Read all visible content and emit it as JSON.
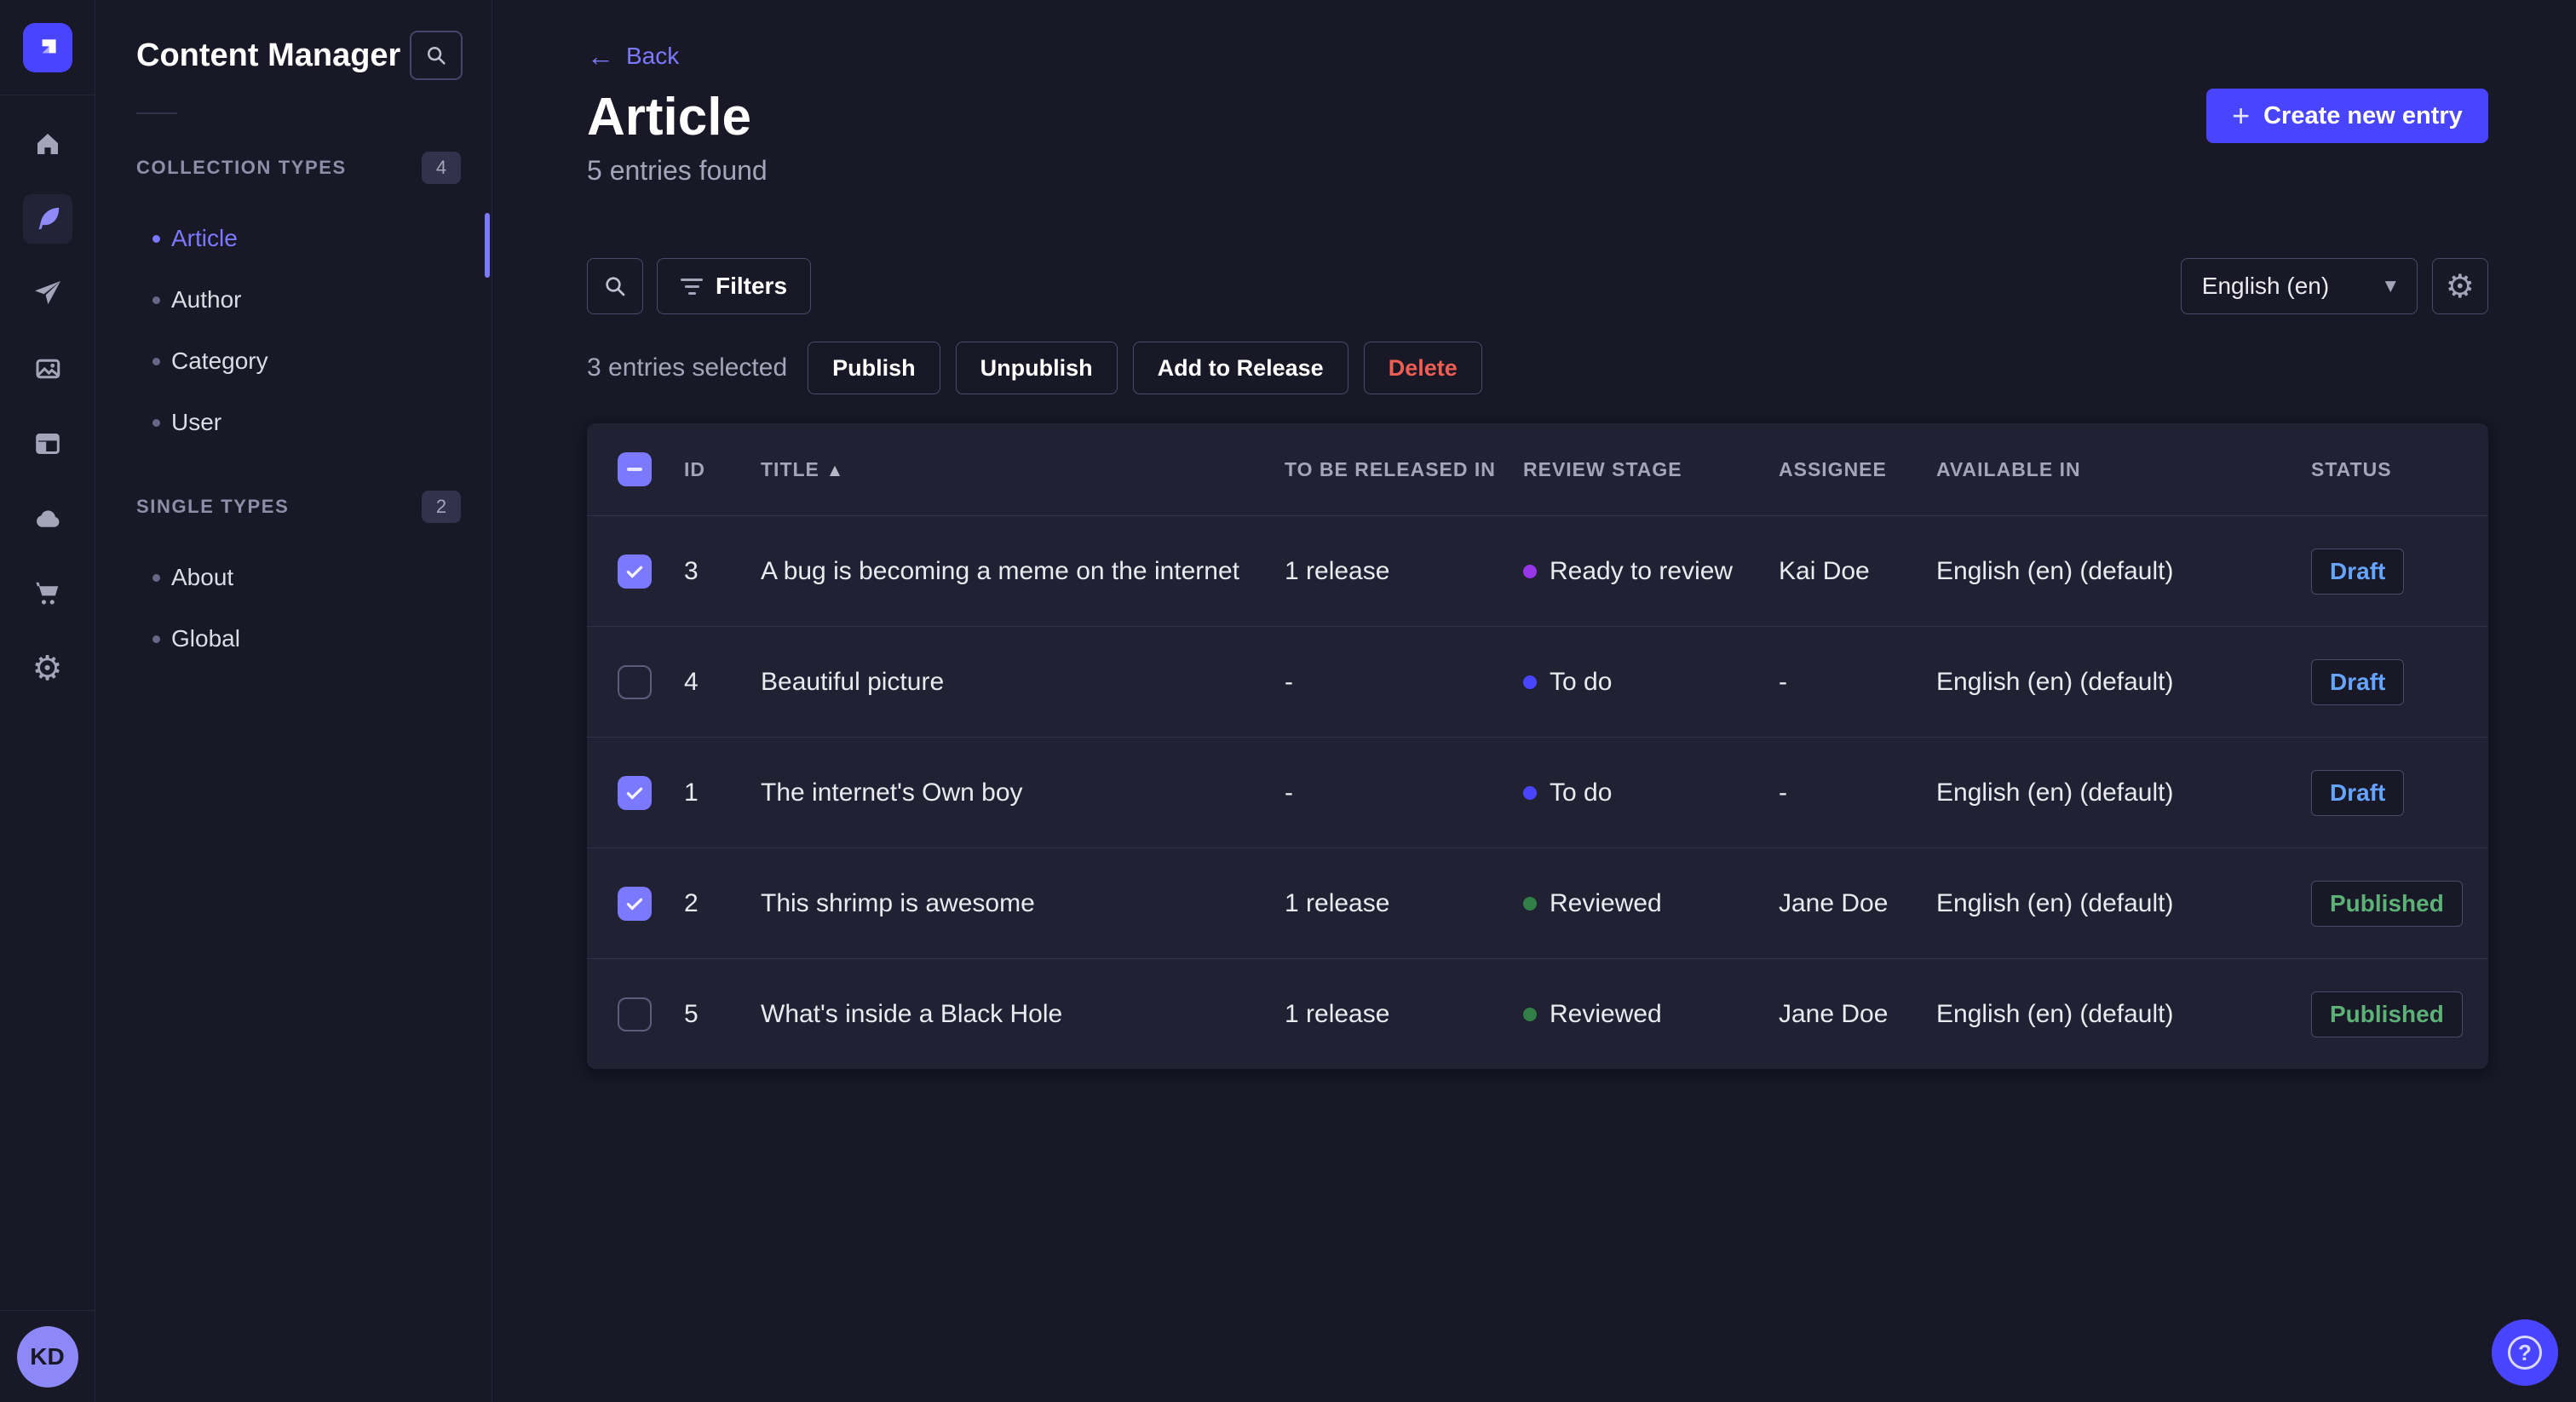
{
  "app": {
    "avatar_initials": "KD"
  },
  "colors": {
    "accent": "#4945ff",
    "accent_light": "#7b79ff",
    "bg": "#181826",
    "surface": "#212134",
    "danger": "#ee5e52",
    "success": "#5cb176",
    "draft": "#66a5ff",
    "avatar_bg": "#8c88f7"
  },
  "icons": {
    "caret_down": "▼",
    "sort_asc": "▲",
    "plus": "+",
    "arrow_left": "←",
    "gear": "⚙",
    "question_mark": "?"
  },
  "sidebar": {
    "title": "Content Manager",
    "sections": [
      {
        "label": "COLLECTION TYPES",
        "count": "4",
        "items": [
          {
            "label": "Article",
            "active": true
          },
          {
            "label": "Author"
          },
          {
            "label": "Category"
          },
          {
            "label": "User"
          }
        ]
      },
      {
        "label": "SINGLE TYPES",
        "count": "2",
        "items": [
          {
            "label": "About"
          },
          {
            "label": "Global"
          }
        ]
      }
    ]
  },
  "header": {
    "back_label": "Back",
    "title": "Article",
    "subtitle": "5 entries found",
    "create_button": "Create new entry"
  },
  "toolbar": {
    "filters_label": "Filters",
    "locale_value": "English (en)"
  },
  "selection": {
    "label": "3 entries selected",
    "actions": [
      {
        "label": "Publish"
      },
      {
        "label": "Unpublish"
      },
      {
        "label": "Add to Release"
      },
      {
        "label": "Delete",
        "variant": "danger"
      }
    ]
  },
  "table": {
    "columns": [
      "ID",
      "TITLE",
      "TO BE RELEASED IN",
      "REVIEW STAGE",
      "ASSIGNEE",
      "AVAILABLE IN",
      "STATUS"
    ],
    "rows": [
      {
        "checked": true,
        "id": "3",
        "title": "A bug is becoming a meme on the internet",
        "release": "1 release",
        "stage": "Ready to review",
        "stage_color": "#9736e8",
        "assignee": "Kai Doe",
        "locale": "English (en) (default)",
        "status": "Draft"
      },
      {
        "checked": false,
        "id": "4",
        "title": "Beautiful picture",
        "release": "-",
        "stage": "To do",
        "stage_color": "#4945ff",
        "assignee": "-",
        "locale": "English (en) (default)",
        "status": "Draft"
      },
      {
        "checked": true,
        "id": "1",
        "title": "The internet's Own boy",
        "release": "-",
        "stage": "To do",
        "stage_color": "#4945ff",
        "assignee": "-",
        "locale": "English (en) (default)",
        "status": "Draft"
      },
      {
        "checked": true,
        "id": "2",
        "title": "This shrimp is awesome",
        "release": "1 release",
        "stage": "Reviewed",
        "stage_color": "#328048",
        "assignee": "Jane Doe",
        "locale": "English (en) (default)",
        "status": "Published"
      },
      {
        "checked": false,
        "id": "5",
        "title": "What's inside a Black Hole",
        "release": "1 release",
        "stage": "Reviewed",
        "stage_color": "#328048",
        "assignee": "Jane Doe",
        "locale": "English (en) (default)",
        "status": "Published"
      }
    ]
  }
}
